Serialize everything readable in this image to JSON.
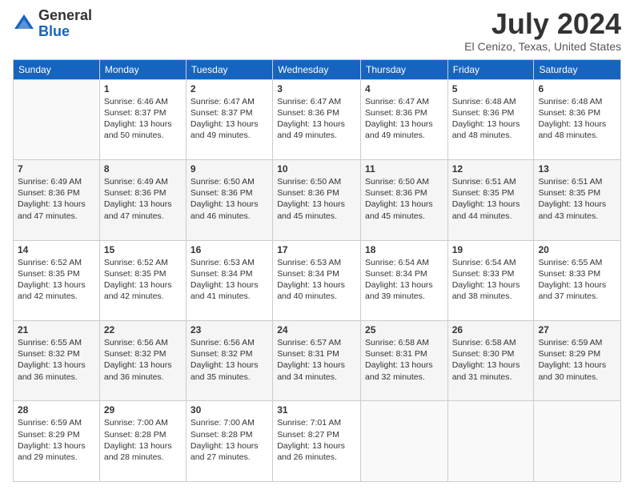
{
  "logo": {
    "general": "General",
    "blue": "Blue"
  },
  "title": "July 2024",
  "subtitle": "El Cenizo, Texas, United States",
  "days_of_week": [
    "Sunday",
    "Monday",
    "Tuesday",
    "Wednesday",
    "Thursday",
    "Friday",
    "Saturday"
  ],
  "weeks": [
    [
      {
        "day": "",
        "info": ""
      },
      {
        "day": "1",
        "info": "Sunrise: 6:46 AM\nSunset: 8:37 PM\nDaylight: 13 hours\nand 50 minutes."
      },
      {
        "day": "2",
        "info": "Sunrise: 6:47 AM\nSunset: 8:37 PM\nDaylight: 13 hours\nand 49 minutes."
      },
      {
        "day": "3",
        "info": "Sunrise: 6:47 AM\nSunset: 8:36 PM\nDaylight: 13 hours\nand 49 minutes."
      },
      {
        "day": "4",
        "info": "Sunrise: 6:47 AM\nSunset: 8:36 PM\nDaylight: 13 hours\nand 49 minutes."
      },
      {
        "day": "5",
        "info": "Sunrise: 6:48 AM\nSunset: 8:36 PM\nDaylight: 13 hours\nand 48 minutes."
      },
      {
        "day": "6",
        "info": "Sunrise: 6:48 AM\nSunset: 8:36 PM\nDaylight: 13 hours\nand 48 minutes."
      }
    ],
    [
      {
        "day": "7",
        "info": "Sunrise: 6:49 AM\nSunset: 8:36 PM\nDaylight: 13 hours\nand 47 minutes."
      },
      {
        "day": "8",
        "info": "Sunrise: 6:49 AM\nSunset: 8:36 PM\nDaylight: 13 hours\nand 47 minutes."
      },
      {
        "day": "9",
        "info": "Sunrise: 6:50 AM\nSunset: 8:36 PM\nDaylight: 13 hours\nand 46 minutes."
      },
      {
        "day": "10",
        "info": "Sunrise: 6:50 AM\nSunset: 8:36 PM\nDaylight: 13 hours\nand 45 minutes."
      },
      {
        "day": "11",
        "info": "Sunrise: 6:50 AM\nSunset: 8:36 PM\nDaylight: 13 hours\nand 45 minutes."
      },
      {
        "day": "12",
        "info": "Sunrise: 6:51 AM\nSunset: 8:35 PM\nDaylight: 13 hours\nand 44 minutes."
      },
      {
        "day": "13",
        "info": "Sunrise: 6:51 AM\nSunset: 8:35 PM\nDaylight: 13 hours\nand 43 minutes."
      }
    ],
    [
      {
        "day": "14",
        "info": "Sunrise: 6:52 AM\nSunset: 8:35 PM\nDaylight: 13 hours\nand 42 minutes."
      },
      {
        "day": "15",
        "info": "Sunrise: 6:52 AM\nSunset: 8:35 PM\nDaylight: 13 hours\nand 42 minutes."
      },
      {
        "day": "16",
        "info": "Sunrise: 6:53 AM\nSunset: 8:34 PM\nDaylight: 13 hours\nand 41 minutes."
      },
      {
        "day": "17",
        "info": "Sunrise: 6:53 AM\nSunset: 8:34 PM\nDaylight: 13 hours\nand 40 minutes."
      },
      {
        "day": "18",
        "info": "Sunrise: 6:54 AM\nSunset: 8:34 PM\nDaylight: 13 hours\nand 39 minutes."
      },
      {
        "day": "19",
        "info": "Sunrise: 6:54 AM\nSunset: 8:33 PM\nDaylight: 13 hours\nand 38 minutes."
      },
      {
        "day": "20",
        "info": "Sunrise: 6:55 AM\nSunset: 8:33 PM\nDaylight: 13 hours\nand 37 minutes."
      }
    ],
    [
      {
        "day": "21",
        "info": "Sunrise: 6:55 AM\nSunset: 8:32 PM\nDaylight: 13 hours\nand 36 minutes."
      },
      {
        "day": "22",
        "info": "Sunrise: 6:56 AM\nSunset: 8:32 PM\nDaylight: 13 hours\nand 36 minutes."
      },
      {
        "day": "23",
        "info": "Sunrise: 6:56 AM\nSunset: 8:32 PM\nDaylight: 13 hours\nand 35 minutes."
      },
      {
        "day": "24",
        "info": "Sunrise: 6:57 AM\nSunset: 8:31 PM\nDaylight: 13 hours\nand 34 minutes."
      },
      {
        "day": "25",
        "info": "Sunrise: 6:58 AM\nSunset: 8:31 PM\nDaylight: 13 hours\nand 32 minutes."
      },
      {
        "day": "26",
        "info": "Sunrise: 6:58 AM\nSunset: 8:30 PM\nDaylight: 13 hours\nand 31 minutes."
      },
      {
        "day": "27",
        "info": "Sunrise: 6:59 AM\nSunset: 8:29 PM\nDaylight: 13 hours\nand 30 minutes."
      }
    ],
    [
      {
        "day": "28",
        "info": "Sunrise: 6:59 AM\nSunset: 8:29 PM\nDaylight: 13 hours\nand 29 minutes."
      },
      {
        "day": "29",
        "info": "Sunrise: 7:00 AM\nSunset: 8:28 PM\nDaylight: 13 hours\nand 28 minutes."
      },
      {
        "day": "30",
        "info": "Sunrise: 7:00 AM\nSunset: 8:28 PM\nDaylight: 13 hours\nand 27 minutes."
      },
      {
        "day": "31",
        "info": "Sunrise: 7:01 AM\nSunset: 8:27 PM\nDaylight: 13 hours\nand 26 minutes."
      },
      {
        "day": "",
        "info": ""
      },
      {
        "day": "",
        "info": ""
      },
      {
        "day": "",
        "info": ""
      }
    ]
  ]
}
